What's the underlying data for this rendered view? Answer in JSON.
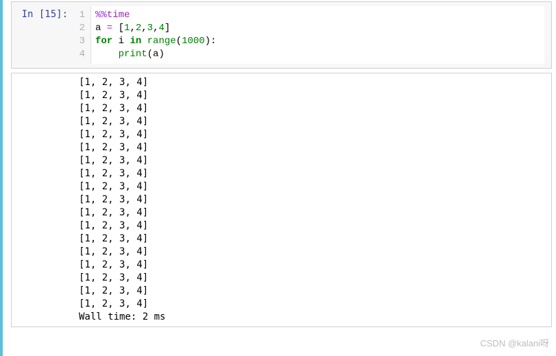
{
  "cell": {
    "prompt": "In [15]:",
    "line_numbers": [
      "1",
      "2",
      "3",
      "4"
    ],
    "code": {
      "l1": {
        "magic": "%%",
        "magic_cmd": "time"
      },
      "l2": {
        "var": "a",
        "assign": " = ",
        "lb": "[",
        "n1": "1",
        "c1": ",",
        "n2": "2",
        "c2": ",",
        "n3": "3",
        "c3": ",",
        "n4": "4",
        "rb": "]"
      },
      "l3": {
        "kw_for": "for",
        "sp1": " ",
        "var_i": "i",
        "sp2": " ",
        "kw_in": "in",
        "sp3": " ",
        "fn": "range",
        "lp": "(",
        "arg": "1000",
        "rp": ")",
        "colon": ":"
      },
      "l4": {
        "indent": "    ",
        "fn": "print",
        "lp": "(",
        "arg": "a",
        "rp": ")"
      }
    }
  },
  "output": {
    "partial_top": "[., ., ., .]",
    "repeat_line": "[1, 2, 3, 4]",
    "repeat_count": 18,
    "wall_time": "Wall time: 2 ms"
  },
  "watermark": "CSDN @kalani呀"
}
